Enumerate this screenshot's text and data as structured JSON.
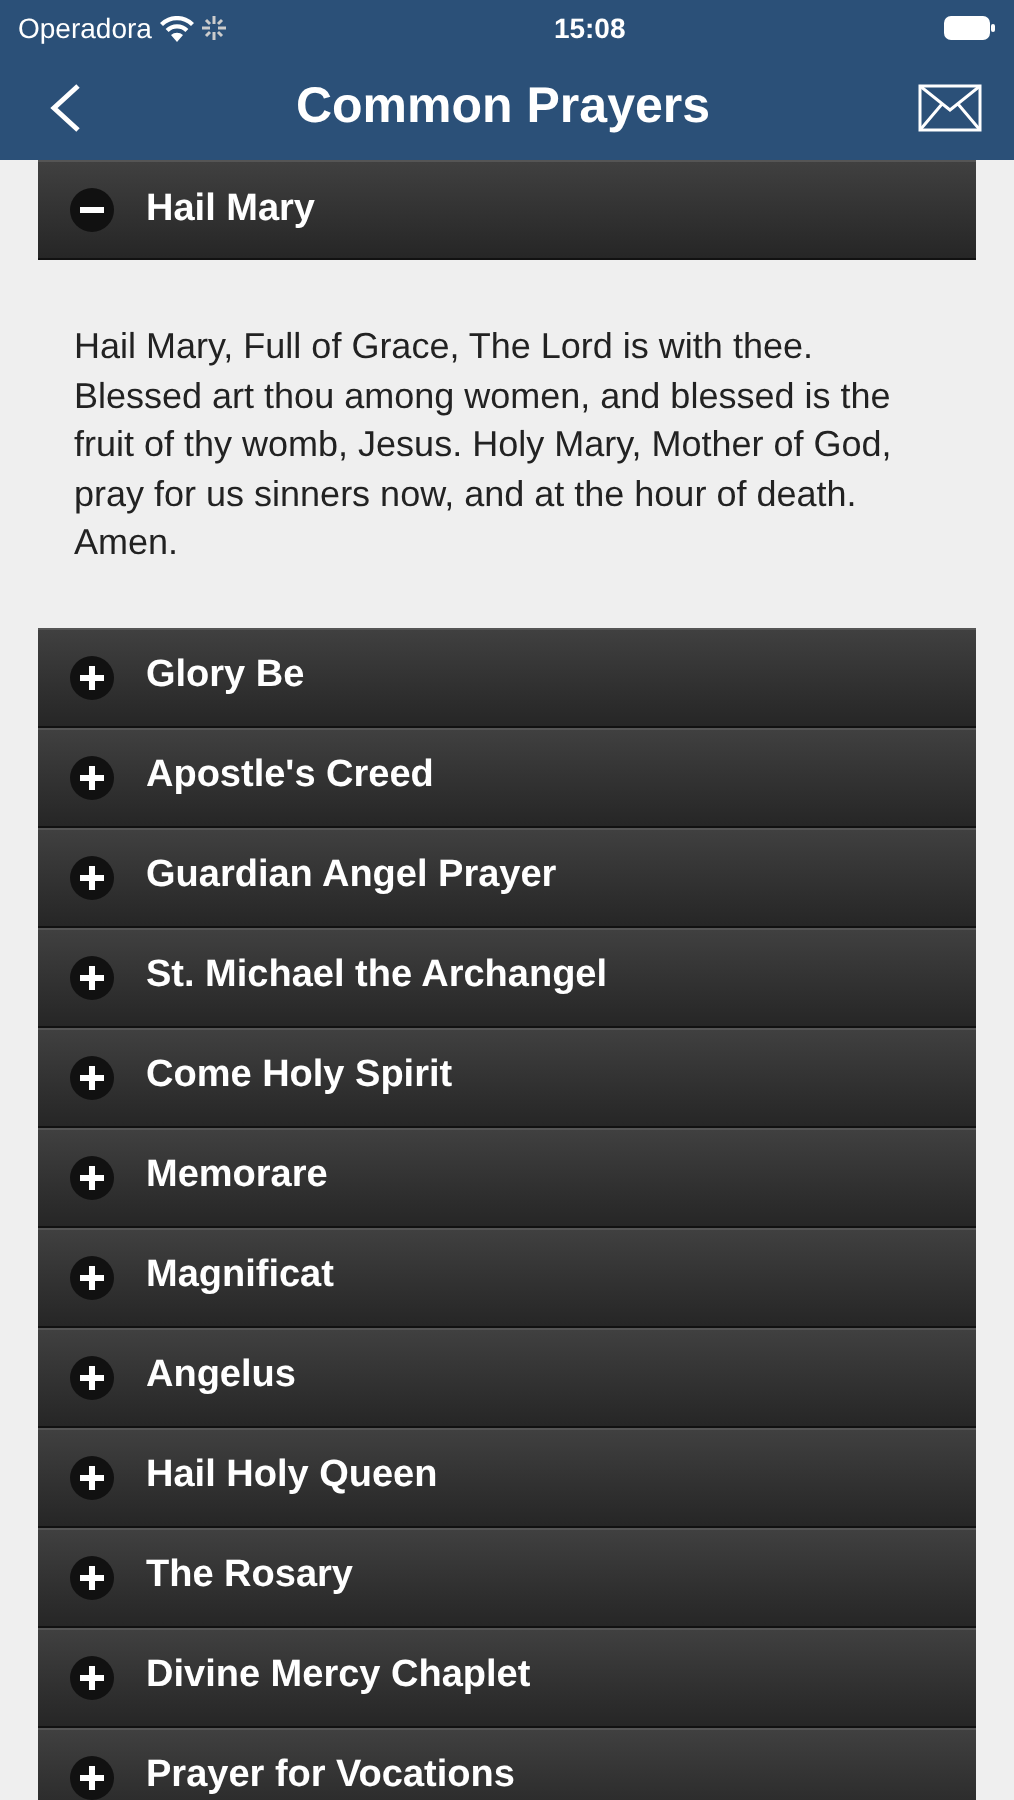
{
  "status_bar": {
    "carrier": "Operadora",
    "time": "15:08"
  },
  "nav": {
    "title": "Common Prayers"
  },
  "prayers": [
    {
      "title": "Hail Mary",
      "expanded": true,
      "text": "Hail Mary, Full of Grace, The Lord is with thee. Blessed art thou among women, and blessed is the fruit of thy womb, Jesus. Holy Mary, Mother of God, pray for us sinners now, and at the hour of death. Amen."
    },
    {
      "title": "Glory Be",
      "expanded": false
    },
    {
      "title": "Apostle's Creed",
      "expanded": false
    },
    {
      "title": "Guardian Angel Prayer",
      "expanded": false
    },
    {
      "title": "St. Michael the Archangel",
      "expanded": false
    },
    {
      "title": "Come Holy Spirit",
      "expanded": false
    },
    {
      "title": "Memorare",
      "expanded": false
    },
    {
      "title": "Magnificat",
      "expanded": false
    },
    {
      "title": "Angelus",
      "expanded": false
    },
    {
      "title": "Hail Holy Queen",
      "expanded": false
    },
    {
      "title": "The Rosary",
      "expanded": false
    },
    {
      "title": "Divine Mercy Chaplet",
      "expanded": false
    },
    {
      "title": "Prayer for Vocations",
      "expanded": false
    }
  ]
}
